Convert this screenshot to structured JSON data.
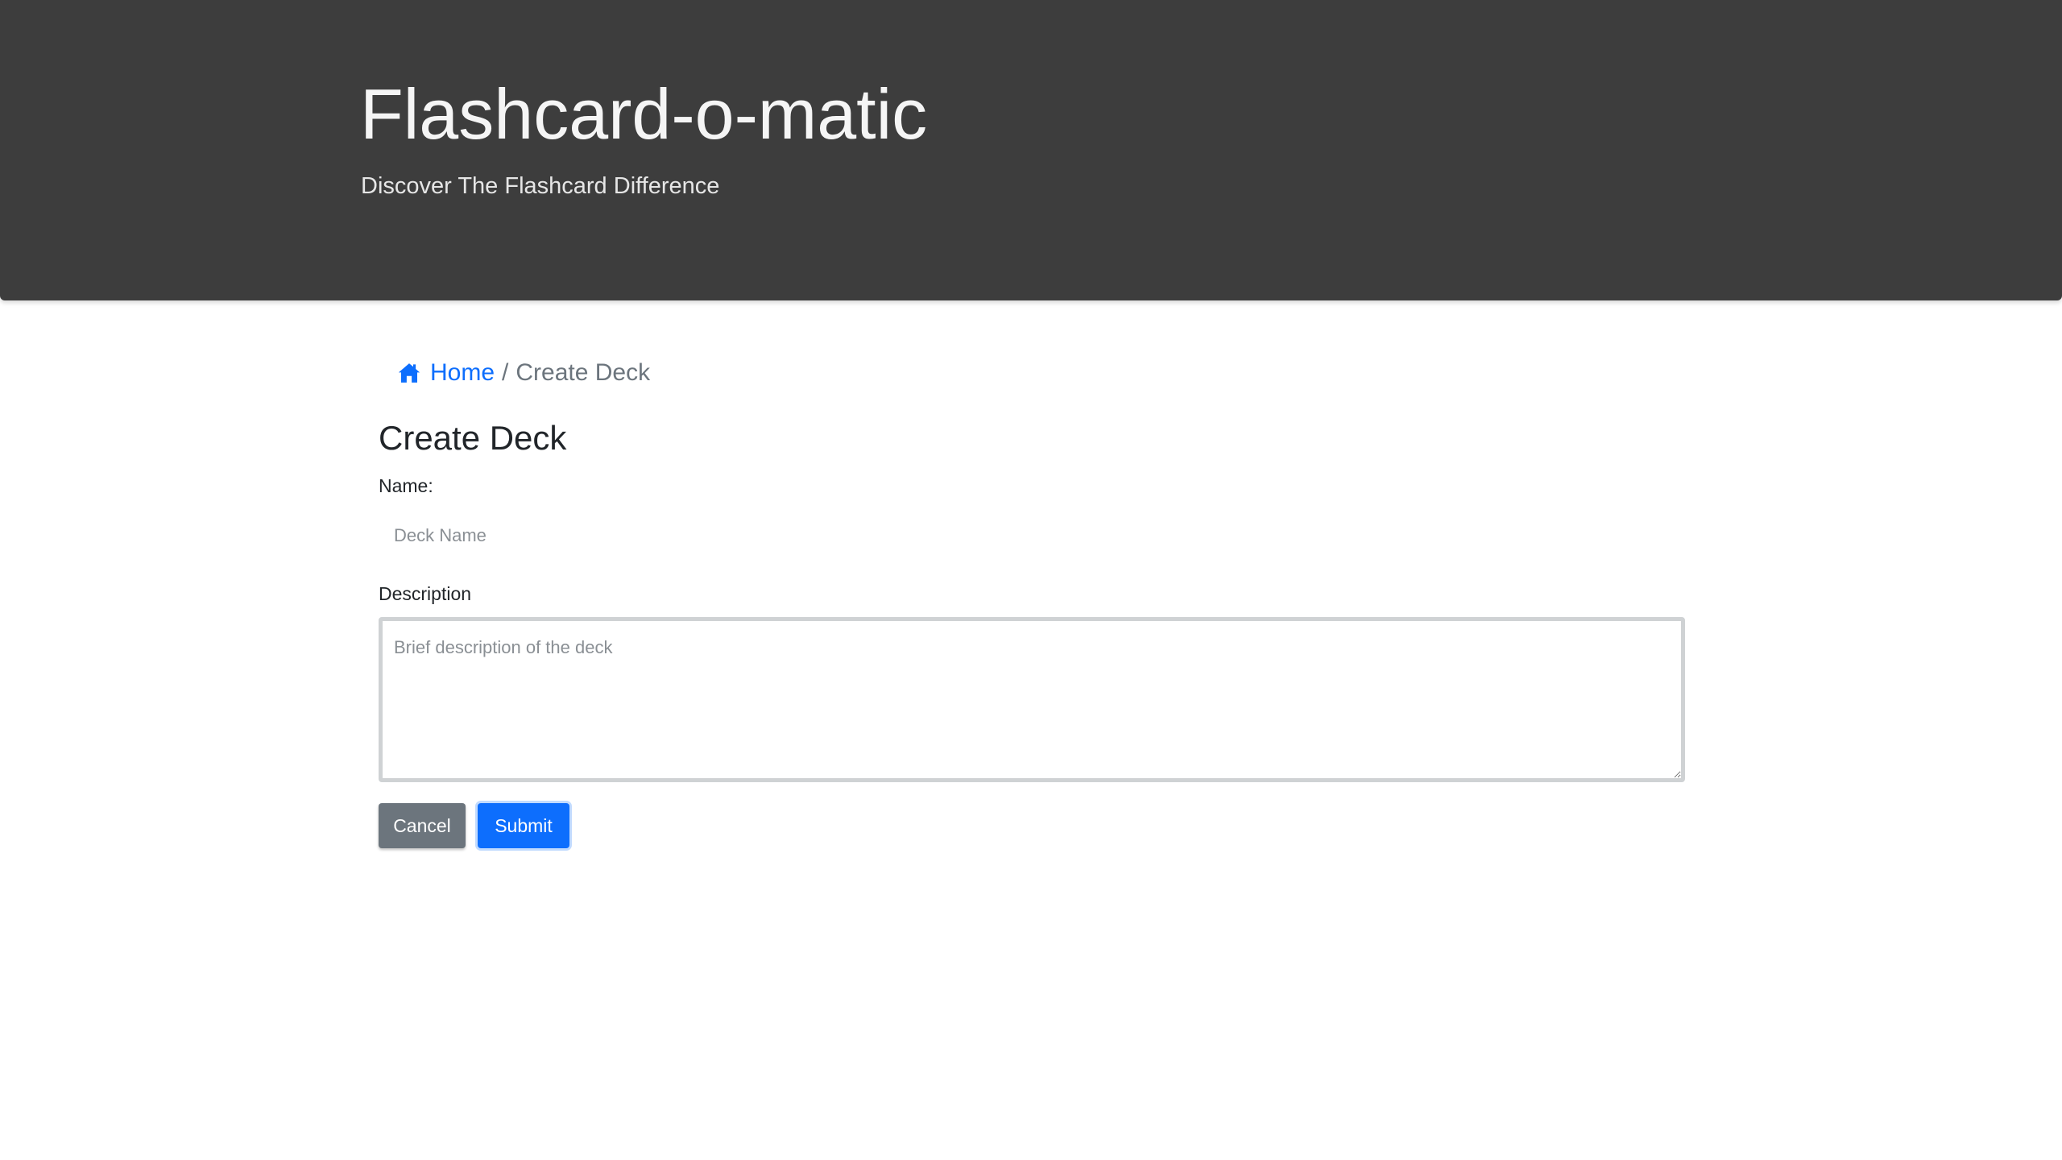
{
  "header": {
    "title": "Flashcard-o-matic",
    "subtitle": "Discover The Flashcard Difference"
  },
  "breadcrumb": {
    "home_icon": "house-icon",
    "home_label": "Home",
    "separator": "/",
    "current": "Create Deck"
  },
  "page": {
    "title": "Create Deck"
  },
  "form": {
    "name_label": "Name:",
    "name_placeholder": "Deck Name",
    "name_value": "",
    "description_label": "Description",
    "description_placeholder": "Brief description of the deck",
    "description_value": ""
  },
  "buttons": {
    "cancel": "Cancel",
    "submit": "Submit"
  },
  "colors": {
    "header_bg": "#3d3d3d",
    "link": "#0d6efd",
    "secondary": "#6c757d",
    "primary": "#0d6efd"
  }
}
